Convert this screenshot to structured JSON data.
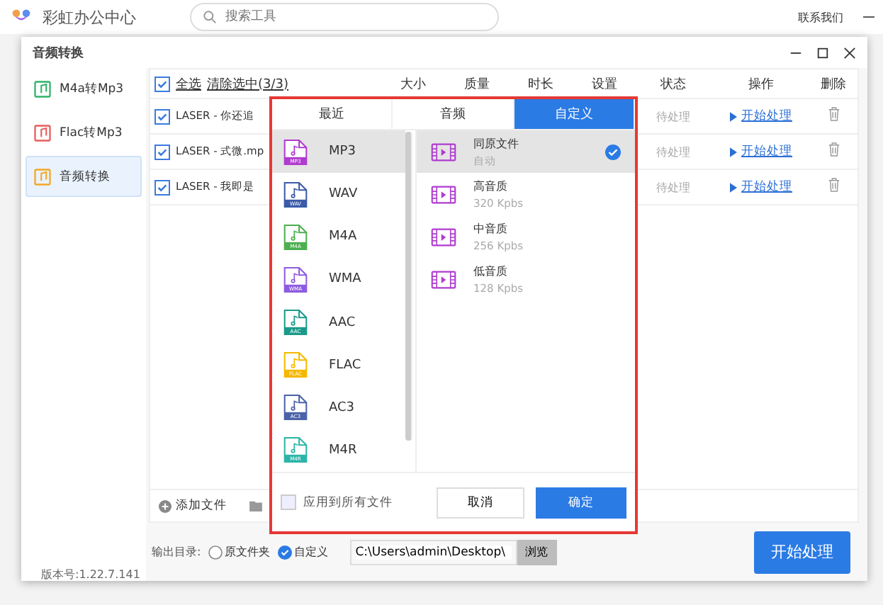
{
  "app": {
    "name": "彩虹办公中心",
    "search": {
      "placeholder": "搜索工具"
    },
    "contact": "联系我们"
  },
  "window": {
    "title": "音频转换"
  },
  "sidebar": {
    "items": [
      {
        "label": "M4a转Mp3",
        "color": "#2fb36b",
        "selected": false
      },
      {
        "label": "Flac转Mp3",
        "color": "#e85c5c",
        "selected": false
      },
      {
        "label": "音频转换",
        "color": "#f5a623",
        "selected": true
      }
    ]
  },
  "table": {
    "select_all": {
      "label": "全选",
      "checked": true
    },
    "clear": "清除选中(3/3)",
    "columns": [
      "大小",
      "质量",
      "时长",
      "设置",
      "状态",
      "操作",
      "删除"
    ],
    "rows": [
      {
        "name": "LASER - 你还追",
        "checked": true,
        "status": "待处理",
        "action": "开始处理"
      },
      {
        "name": "LASER - 式微.mp",
        "checked": true,
        "status": "待处理",
        "action": "开始处理"
      },
      {
        "name": "LASER - 我即是",
        "checked": true,
        "status": "待处理",
        "action": "开始处理"
      }
    ],
    "add_file": "添加文件"
  },
  "popup": {
    "tabs": [
      {
        "label": "最近",
        "selected": false
      },
      {
        "label": "音频",
        "selected": false
      },
      {
        "label": "自定义",
        "selected": true
      }
    ],
    "formats": [
      {
        "label": "MP3",
        "icon_label": "MP3",
        "color": "#b03ccf",
        "selected": true
      },
      {
        "label": "WAV",
        "icon_label": "WAV",
        "color": "#3b5ba8",
        "selected": false
      },
      {
        "label": "M4A",
        "icon_label": "M4A",
        "color": "#4caf50",
        "selected": false
      },
      {
        "label": "WMA",
        "icon_label": "WMA",
        "color": "#8e5ce0",
        "selected": false
      },
      {
        "label": "AAC",
        "icon_label": "AAC",
        "color": "#1a9b8a",
        "selected": false
      },
      {
        "label": "FLAC",
        "icon_label": "FLAC",
        "color": "#f5b800",
        "selected": false
      },
      {
        "label": "AC3",
        "icon_label": "AC3",
        "color": "#4a62a8",
        "selected": false
      },
      {
        "label": "M4R",
        "icon_label": "M4R",
        "color": "#2bb5a8",
        "selected": false
      }
    ],
    "qualities": [
      {
        "title": "同原文件",
        "detail": "自动",
        "selected": true
      },
      {
        "title": "高音质",
        "detail": "320 Kpbs",
        "selected": false
      },
      {
        "title": "中音质",
        "detail": "256 Kpbs",
        "selected": false
      },
      {
        "title": "低音质",
        "detail": "128 Kpbs",
        "selected": false
      }
    ],
    "apply_all": {
      "label": "应用到所有文件",
      "checked": false
    },
    "cancel": "取消",
    "confirm": "确定"
  },
  "output": {
    "label": "输出目录:",
    "options": [
      {
        "label": "原文件夹",
        "selected": false
      },
      {
        "label": "自定义",
        "selected": true
      }
    ],
    "path": "C:\\Users\\admin\\Desktop\\",
    "browse": "浏览"
  },
  "start": "开始处理",
  "version": "版本号:1.22.7.141"
}
